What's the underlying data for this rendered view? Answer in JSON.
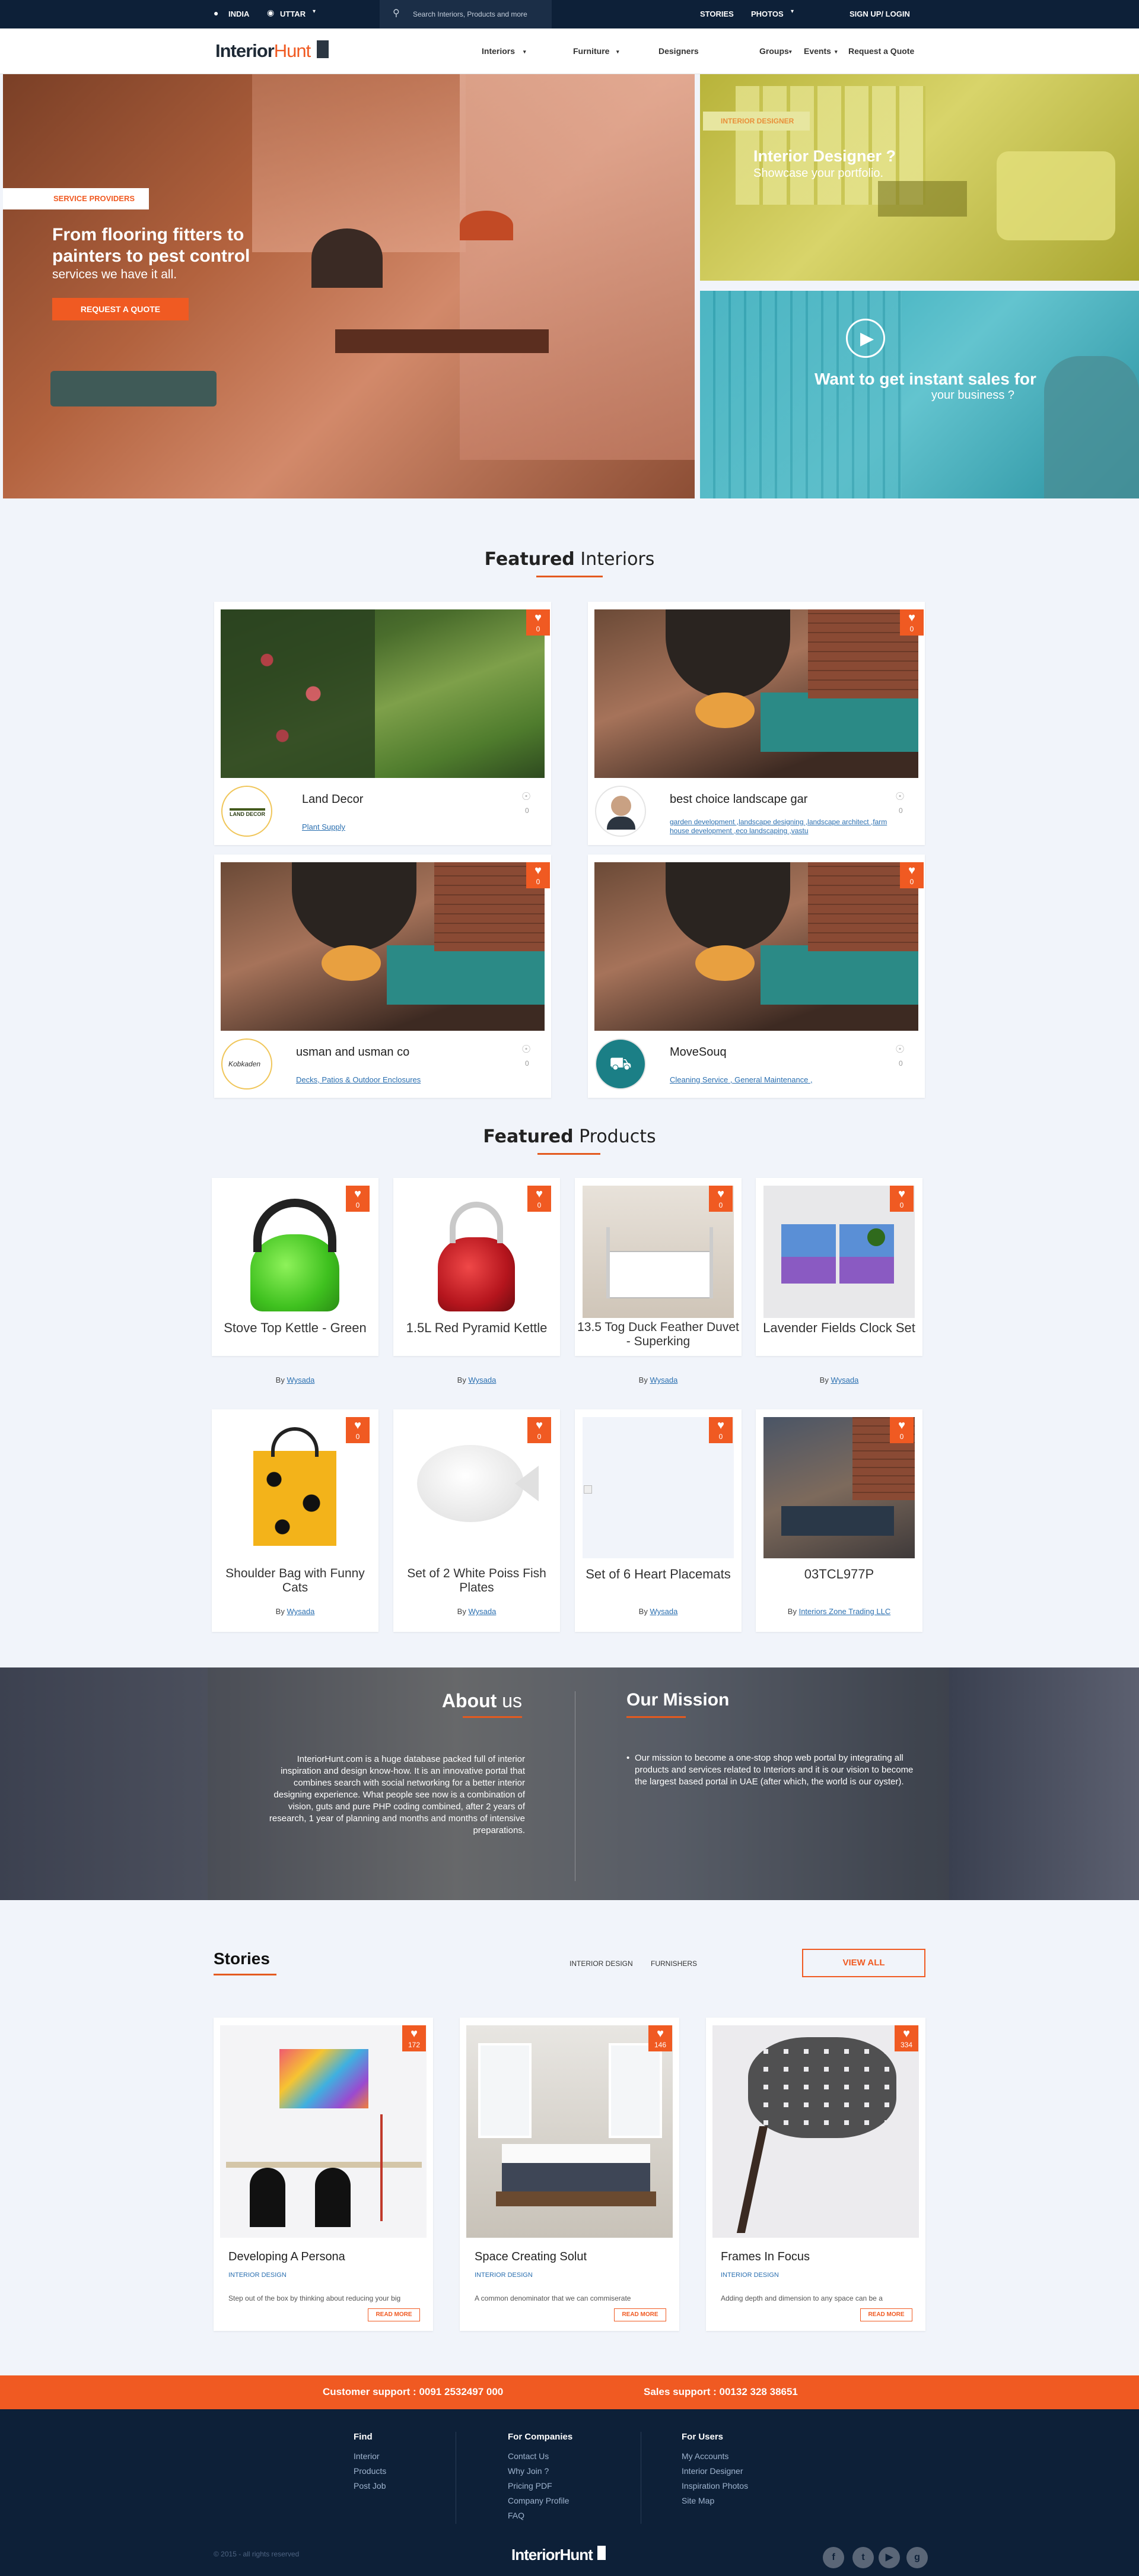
{
  "topbar": {
    "country": "INDIA",
    "region": "UTTAR",
    "search_placeholder": "Search Interiors, Products and more",
    "stories": "STORIES",
    "photos": "PHOTOS",
    "signup": "SIGN UP/ LOGIN"
  },
  "nav": {
    "logo_text_dark": "Interior",
    "logo_text_accent": "Hunt",
    "items": [
      "Interiors",
      "Furniture",
      "Designers",
      "Groups",
      "Events",
      "Request a Quote"
    ]
  },
  "hero": {
    "badge": "SERVICE PROVIDERS",
    "headline_line1": "From flooring fitters to",
    "headline_line2": "painters to pest control",
    "sub": "services we have it all.",
    "cta": "REQUEST A QUOTE",
    "designer_badge": "INTERIOR DESIGNER",
    "designer_title": "Interior Designer ?",
    "designer_sub": "Showcase your portfolio.",
    "sales_title": "Want to get instant sales for",
    "sales_sub": "your business ?"
  },
  "featured_interiors": {
    "title_bold": "Featured",
    "title_light": "Interiors",
    "items": [
      {
        "name": "Land Decor",
        "tags": "Plant Supply",
        "count": "0",
        "views": "0",
        "logo": "LAND DECOR"
      },
      {
        "name": "best choice landscape gar",
        "tags": "garden development ,landscape designing ,landscape architect ,farm house development ,eco landscaping ,vastu",
        "count": "0",
        "views": "0",
        "logo": ""
      },
      {
        "name": "usman and usman co",
        "tags": "Decks, Patios & Outdoor Enclosures",
        "count": "0",
        "views": "0",
        "logo": "Kobkaden"
      },
      {
        "name": "MoveSouq",
        "tags": "Cleaning Service , General Maintenance ,",
        "count": "0",
        "views": "0",
        "logo": ""
      }
    ]
  },
  "featured_products": {
    "title_bold": "Featured",
    "title_light": "Products",
    "by_label": "By",
    "items": [
      {
        "name": "Stove Top Kettle - Green",
        "vendor": "Wysada",
        "count": "0"
      },
      {
        "name": "1.5L Red Pyramid Kettle",
        "vendor": "Wysada",
        "count": "0"
      },
      {
        "name": "13.5 Tog Duck Feather Duvet - Superking",
        "vendor": "Wysada",
        "count": "0"
      },
      {
        "name": "Lavender Fields Clock Set",
        "vendor": "Wysada",
        "count": "0"
      },
      {
        "name": "Shoulder Bag with Funny Cats",
        "vendor": "Wysada",
        "count": "0"
      },
      {
        "name": "Set of 2 White Poiss Fish Plates",
        "vendor": "Wysada",
        "count": "0"
      },
      {
        "name": "Set of 6 Heart Placemats",
        "vendor": "Wysada",
        "count": "0"
      },
      {
        "name": "03TCL977P",
        "vendor": "Interiors Zone Trading LLC",
        "count": "0"
      }
    ]
  },
  "about": {
    "title_bold": "About",
    "title_light": "us",
    "text": "InteriorHunt.com is a huge database packed full of interior inspiration and design know-how. It is an innovative portal that combines search with social networking for a better interior designing experience. What people see now is a combination of vision, guts and pure PHP coding combined, after 2 years of research, 1 year of planning and months and months of intensive preparations.",
    "mission_title": "Our Mission",
    "mission_text": "Our mission to become a one-stop shop web portal by integrating all products and services related to Interiors and it is our vision to become the largest based portal in UAE (after which, the world is our oyster)."
  },
  "stories": {
    "title": "Stories",
    "filters": [
      "INTERIOR DESIGN",
      "FURNISHERS"
    ],
    "view_all": "VIEW ALL",
    "read_more": "READ MORE",
    "items": [
      {
        "title": "Developing A Persona",
        "category": "INTERIOR DESIGN",
        "excerpt": "Step out of the box by thinking about reducing your big",
        "count": "172"
      },
      {
        "title": "Space Creating Solut",
        "category": "INTERIOR DESIGN",
        "excerpt": "A common denominator that we can commiserate",
        "count": "146"
      },
      {
        "title": "Frames In Focus",
        "category": "INTERIOR DESIGN",
        "excerpt": "Adding depth and dimension to any space can be a",
        "count": "334"
      }
    ]
  },
  "support": {
    "customer": "Customer support : 0091 2532497 000",
    "sales": "Sales support : 00132 328 38651"
  },
  "footer": {
    "find_title": "Find",
    "find": [
      "Interior",
      "Products",
      "Post Job"
    ],
    "companies_title": "For Companies",
    "companies": [
      "Contact Us",
      "Why Join ?",
      "Pricing PDF",
      "Company Profile",
      "FAQ"
    ],
    "users_title": "For Users",
    "users": [
      "My Accounts",
      "Interior Designer",
      "Inspiration Photos",
      "Site Map"
    ],
    "copyright": "© 2015 - all rights reserved",
    "logo_text": "InteriorHunt"
  },
  "colors": {
    "accent": "#f05a22",
    "navy": "#0d2038",
    "link": "#2a6fb0"
  }
}
